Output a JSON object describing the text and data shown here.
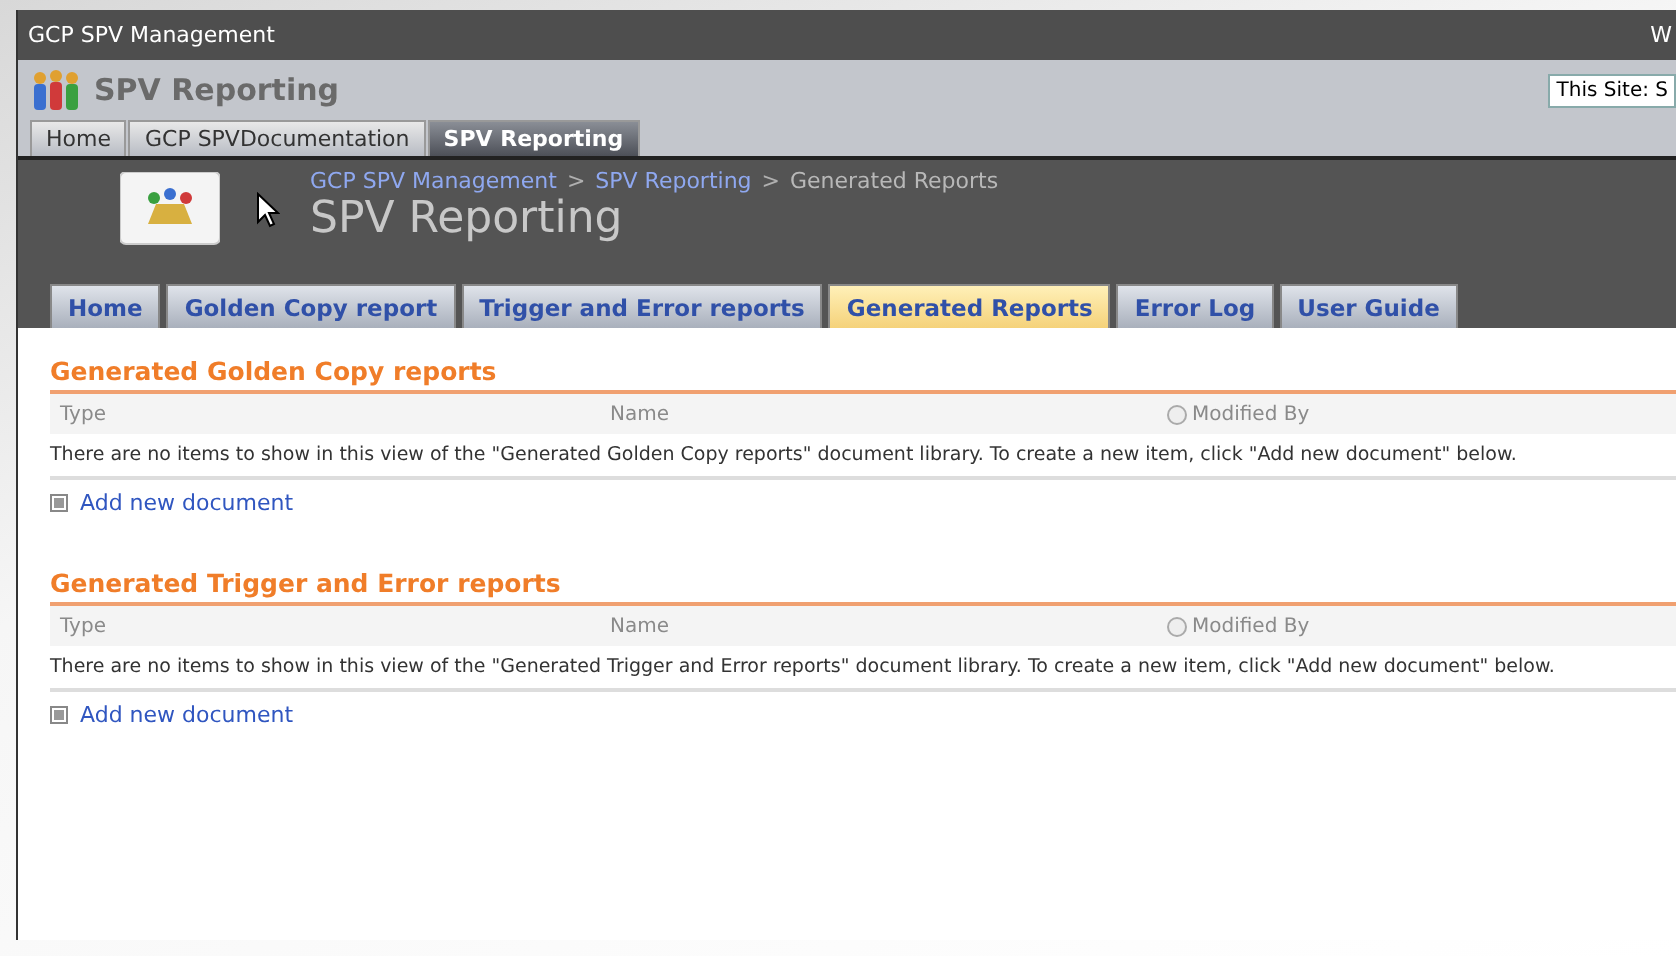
{
  "window": {
    "title": "GCP SPV Management",
    "corner_text": "W"
  },
  "site": {
    "title": "SPV Reporting",
    "search_scope": "This Site: S"
  },
  "top_tabs": [
    {
      "label": "Home",
      "selected": false
    },
    {
      "label": "GCP SPVDocumentation",
      "selected": false
    },
    {
      "label": "SPV Reporting",
      "selected": true
    }
  ],
  "breadcrumb": [
    {
      "label": "GCP SPV Management",
      "link": true
    },
    {
      "label": "SPV Reporting",
      "link": true
    },
    {
      "label": "Generated Reports",
      "link": false
    }
  ],
  "breadcrumb_separator": ">",
  "page_title": "SPV Reporting",
  "nav_tabs": [
    {
      "label": "Home",
      "selected": false
    },
    {
      "label": "Golden Copy report",
      "selected": false
    },
    {
      "label": "Trigger and Error reports",
      "selected": false
    },
    {
      "label": "Generated Reports",
      "selected": true
    },
    {
      "label": "Error Log",
      "selected": false
    },
    {
      "label": "User Guide",
      "selected": false
    }
  ],
  "libraries": [
    {
      "title": "Generated Golden Copy reports",
      "columns": [
        "Type",
        "Name",
        "Modified By"
      ],
      "empty_message": "There are no items to show in this view of the \"Generated Golden Copy reports\" document library. To create a new item, click \"Add new document\" below.",
      "add_link": "Add new document"
    },
    {
      "title": "Generated Trigger and Error reports",
      "columns": [
        "Type",
        "Name",
        "Modified By"
      ],
      "empty_message": "There are no items to show in this view of the \"Generated Trigger and Error reports\" document library. To create a new item, click \"Add new document\" below.",
      "add_link": "Add new document"
    }
  ]
}
